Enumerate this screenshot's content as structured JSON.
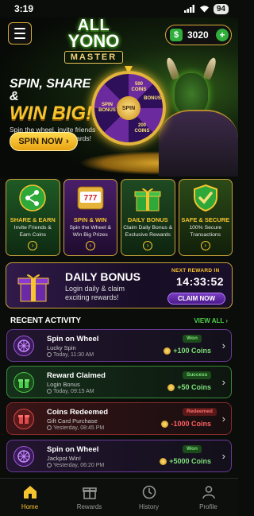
{
  "status": {
    "time": "3:19",
    "battery": "94"
  },
  "header": {
    "balance": "3020",
    "balance_add": "+"
  },
  "logo": {
    "line1": "ALL",
    "line2": "YONO",
    "line3": "MASTER"
  },
  "hero": {
    "title1": "SPIN, SHARE &",
    "title2": "WIN BIG!",
    "subtitle": "Spin the wheel, invite friends and earn amazing rewards!",
    "cta": "SPIN NOW",
    "wheel_center": "SPIN",
    "wheel_labels": [
      "500 COINS",
      "SPIN BONUS",
      "200 COINS",
      "BONUS"
    ]
  },
  "features": [
    {
      "title": "SHARE & EARN",
      "desc": "Invite Friends & Earn Coins",
      "icon": "share-icon"
    },
    {
      "title": "SPIN & WIN",
      "desc": "Spin the Wheel & Win Big Prizes",
      "icon": "slot-machine-icon",
      "slot": "777"
    },
    {
      "title": "DAILY BONUS",
      "desc": "Claim Daily Bonus & Exclusive Rewards",
      "icon": "gift-icon"
    },
    {
      "title": "SAFE & SECURE",
      "desc": "100% Secure Transactions",
      "icon": "shield-check-icon"
    }
  ],
  "daily_bonus": {
    "title": "DAILY BONUS",
    "subtitle": "Login daily & claim exciting rewards!",
    "next_label": "NEXT REWARD IN",
    "timer": "14:33:52",
    "claim": "CLAIM NOW"
  },
  "recent": {
    "title": "RECENT ACTIVITY",
    "view_all": "VIEW ALL",
    "items": [
      {
        "title": "Spin on Wheel",
        "sub": "Lucky Spin",
        "time": "Today, 11:30 AM",
        "badge": "Won",
        "amount": "+100 Coins",
        "icon": "wheel-icon"
      },
      {
        "title": "Reward Claimed",
        "sub": "Login Bonus",
        "time": "Today, 09:15 AM",
        "badge": "Success",
        "amount": "+50 Coins",
        "icon": "gift-icon"
      },
      {
        "title": "Coins Redeemed",
        "sub": "Gift Card Purchase",
        "time": "Yesterday, 08:45 PM",
        "badge": "Redeemed",
        "amount": "-1000 Coins",
        "icon": "redeem-icon"
      },
      {
        "title": "Spin on Wheel",
        "sub": "Jackpot Win!",
        "time": "Yesterday, 06:20 PM",
        "badge": "Won",
        "amount": "+5000 Coins",
        "icon": "wheel-icon"
      }
    ]
  },
  "nav": [
    {
      "label": "Home",
      "icon": "home-icon",
      "active": true
    },
    {
      "label": "Rewards",
      "icon": "gift-icon"
    },
    {
      "label": "History",
      "icon": "history-icon"
    },
    {
      "label": "Profile",
      "icon": "user-icon"
    }
  ],
  "colors": {
    "accent": "#f6c42e",
    "positive": "#7fe07a",
    "negative": "#ff6060",
    "purple": "#7a3cc0"
  }
}
